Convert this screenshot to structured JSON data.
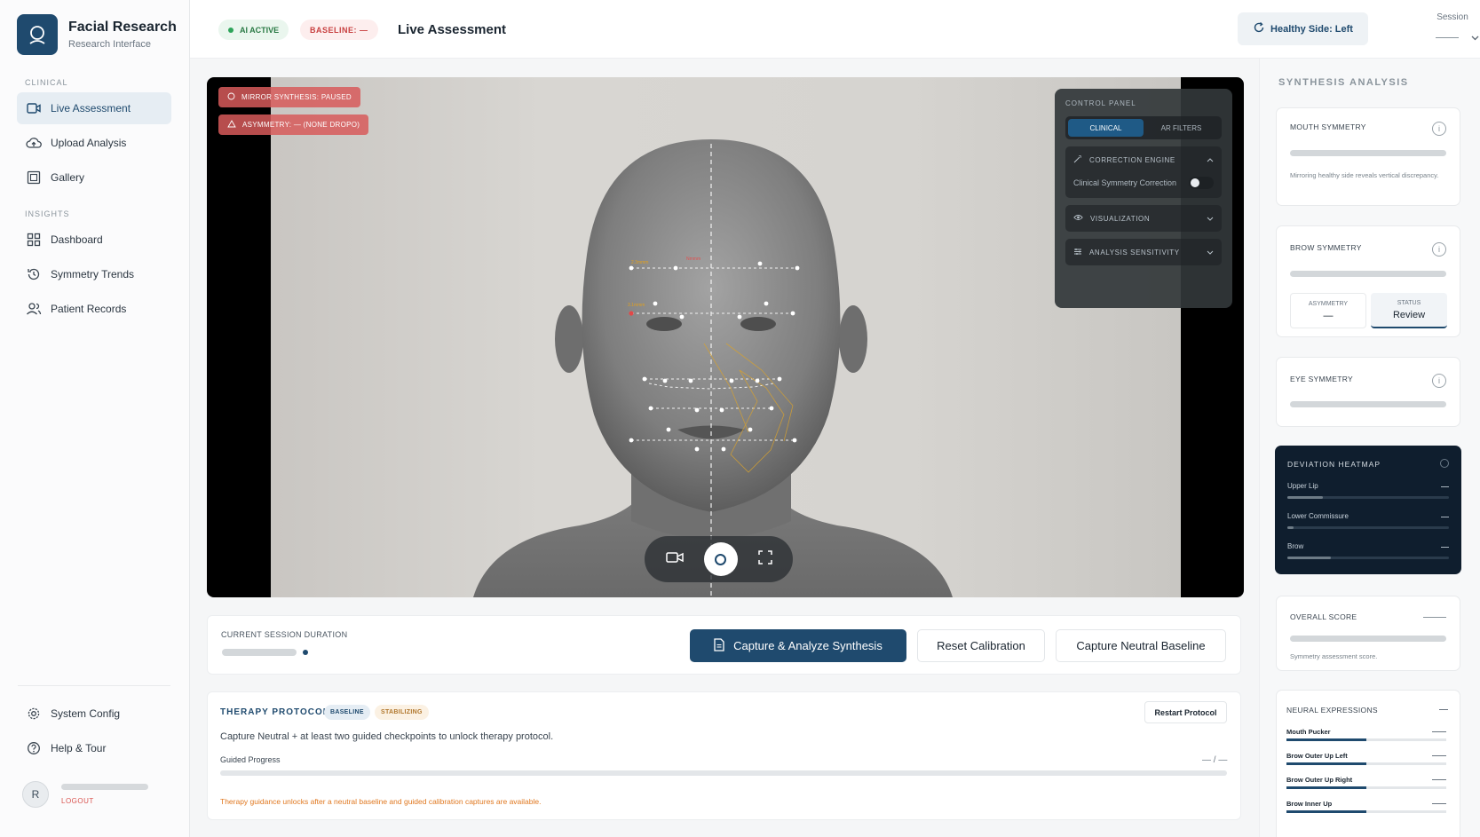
{
  "brand": {
    "title": "Facial Research",
    "subtitle": "Research Interface"
  },
  "sidebar": {
    "section_clinical": "CLINICAL",
    "section_insights": "INSIGHTS",
    "items": [
      {
        "label": "Live Assessment",
        "icon": "video-icon",
        "active": true
      },
      {
        "label": "Upload Analysis",
        "icon": "upload-cloud-icon"
      },
      {
        "label": "Gallery",
        "icon": "gallery-icon"
      },
      {
        "label": "Dashboard",
        "icon": "grid-icon"
      },
      {
        "label": "Symmetry Trends",
        "icon": "history-icon"
      },
      {
        "label": "Patient Records",
        "icon": "users-icon"
      }
    ],
    "footer_items": [
      {
        "label": "System Config",
        "icon": "gear-icon"
      },
      {
        "label": "Help & Tour",
        "icon": "help-icon"
      }
    ],
    "user": {
      "initial": "R",
      "logout": "LOGOUT"
    }
  },
  "header": {
    "ai_badge": "AI ACTIVE",
    "baseline_badge": "BASELINE:  —",
    "title": "Live Assessment",
    "healthy_side": "Healthy Side: Left",
    "session_label": "Session"
  },
  "camera": {
    "tag_mirror": "MIRROR SYNTHESIS: PAUSED",
    "tag_asymmetry": "ASYMMETRY: —  (NONE DROPO)",
    "measure_labels": [
      "2.3mmm",
      "Nmmm",
      "3.1mmm"
    ],
    "control_panel": {
      "title": "CONTROL PANEL",
      "tab_clinical": "CLINICAL",
      "tab_ar": "AR FILTERS",
      "correction_engine": "CORRECTION ENGINE",
      "toggle_label": "Clinical Symmetry Correction",
      "visualization": "VISUALIZATION",
      "sensitivity": "ANALYSIS SENSITIVITY"
    }
  },
  "actions": {
    "duration_label": "CURRENT SESSION DURATION",
    "capture_analyze": "Capture & Analyze Synthesis",
    "reset_calibration": "Reset Calibration",
    "capture_baseline": "Capture Neutral Baseline"
  },
  "therapy": {
    "title": "THERAPY PROTOCOL",
    "pill_baseline": "BASELINE",
    "pill_stabilizing": "STABILIZING",
    "restart": "Restart Protocol",
    "description": "Capture Neutral + at least two guided checkpoints to unlock therapy protocol.",
    "progress_label": "Guided Progress",
    "progress_value": "— / —",
    "note": "Therapy guidance unlocks after a neutral baseline and guided calibration captures are available."
  },
  "analysis": {
    "title": "SYNTHESIS ANALYSIS",
    "mouth": {
      "title": "MOUTH SYMMETRY",
      "desc": "Mirroring healthy side reveals vertical discrepancy."
    },
    "brow": {
      "title": "BROW SYMMETRY",
      "asym_label": "ASYMMETRY",
      "asym_value": "—",
      "status_label": "STATUS",
      "status_value": "Review"
    },
    "eye": {
      "title": "EYE SYMMETRY"
    },
    "heatmap": {
      "title": "DEVIATION HEATMAP",
      "rows": [
        {
          "label": "Upper Lip",
          "value": "—",
          "level": 0.22
        },
        {
          "label": "Lower Commissure",
          "value": "—",
          "level": 0.04
        },
        {
          "label": "Brow",
          "value": "—",
          "level": 0.27
        }
      ]
    },
    "overall": {
      "title": "OVERALL SCORE",
      "value": "—",
      "desc": "Symmetry assessment score."
    },
    "neural": {
      "title": "NEURAL EXPRESSIONS",
      "value": "—",
      "rows": [
        {
          "label": "Mouth Pucker",
          "value": "—",
          "level": 0.5
        },
        {
          "label": "Brow Outer Up Left",
          "value": "—",
          "level": 0.5
        },
        {
          "label": "Brow Outer Up Right",
          "value": "—",
          "level": 0.5
        },
        {
          "label": "Brow Inner Up",
          "value": "—",
          "level": 0.5
        }
      ]
    }
  },
  "colors": {
    "primary": "#1f4a6e",
    "danger": "#d9534f",
    "success": "#2ea45a",
    "warning": "#e07820",
    "heatmap_bg": "#0f1e2e"
  }
}
